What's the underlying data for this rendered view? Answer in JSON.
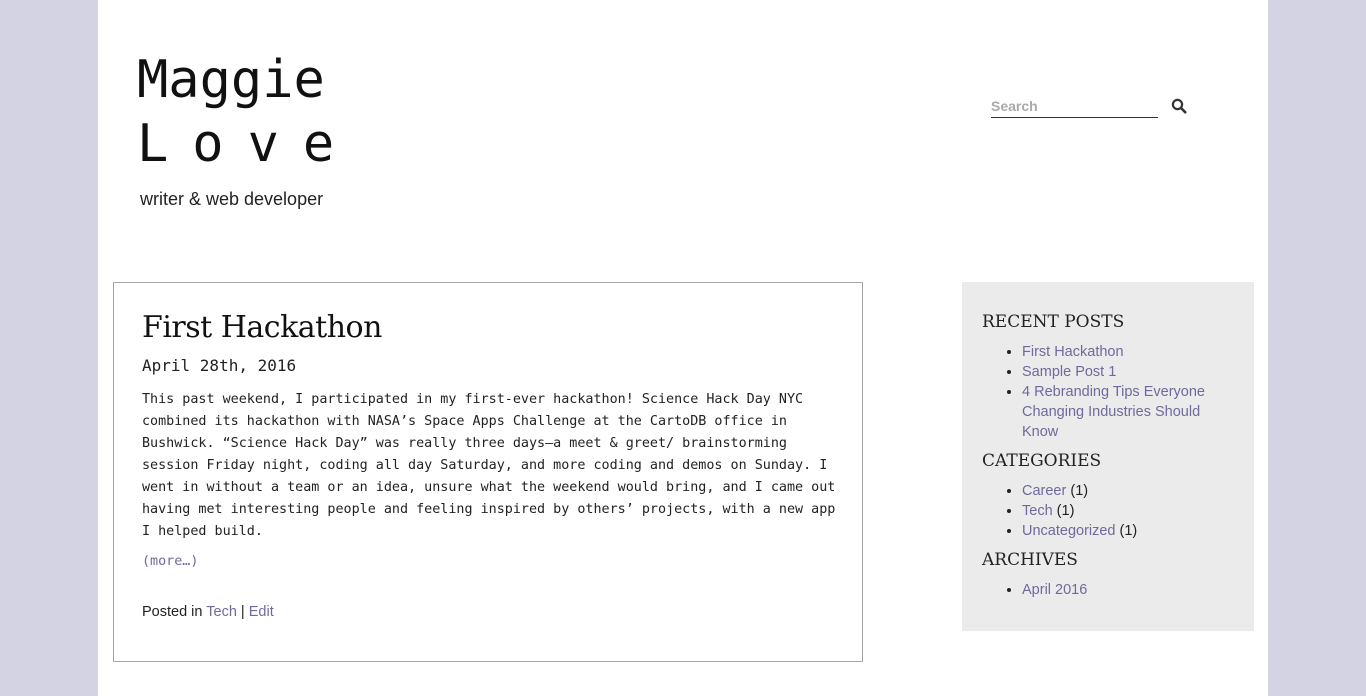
{
  "site": {
    "title_line1": "Maggie",
    "title_line2": "Love",
    "tagline": "writer & web developer"
  },
  "search": {
    "placeholder": "Search",
    "icon": "search-icon"
  },
  "post": {
    "title": "First Hackathon",
    "date": "April 28th, 2016",
    "excerpt": "This past weekend, I participated in my first-ever hackathon! Science Hack Day NYC combined its hackathon with NASA’s Space Apps Challenge at the CartoDB office in Bushwick. “Science Hack Day” was really three days—a meet & greet/ brainstorming session Friday night, coding all day Saturday, and more coding and demos on Sunday. I went in without a team or an idea, unsure what the weekend would bring, and I came out having met interesting people and feeling inspired by others’ projects, with a new app I helped build.",
    "more_label": "(more…)",
    "meta_prefix": "Posted in",
    "category_link": "Tech",
    "separator": "|",
    "edit_link": "Edit"
  },
  "sidebar": {
    "recent_posts": {
      "title": "RECENT POSTS",
      "items": [
        {
          "label": "First Hackathon"
        },
        {
          "label": "Sample Post 1"
        },
        {
          "label": "4 Rebranding Tips Everyone Changing Industries Should Know"
        }
      ]
    },
    "categories": {
      "title": "CATEGORIES",
      "items": [
        {
          "label": "Career",
          "count": "(1)"
        },
        {
          "label": "Tech",
          "count": "(1)"
        },
        {
          "label": "Uncategorized",
          "count": "(1)"
        }
      ]
    },
    "archives": {
      "title": "ARCHIVES",
      "items": [
        {
          "label": "April 2016"
        }
      ]
    }
  },
  "colors": {
    "background": "#d4d3e3",
    "link": "#6e6a9c",
    "sidebar_bg": "#ebebeb"
  }
}
